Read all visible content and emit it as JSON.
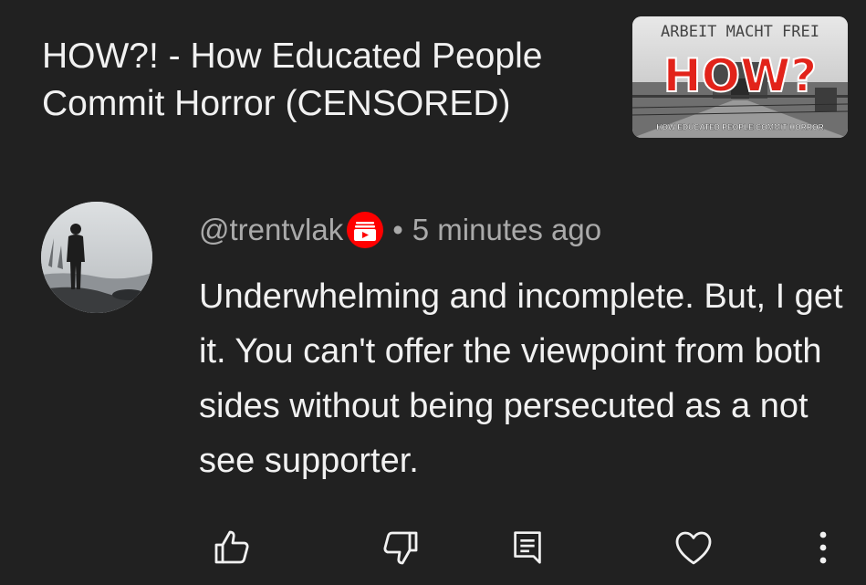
{
  "video": {
    "title": "HOW?! - How Educated People Commit Horror (CENSORED)",
    "thumbnail": {
      "top_sign": "ARBEIT MACHT FREI",
      "headline": "HOW?",
      "subline": "HOW EDUCATED PEOPLE COMMIT HORROR"
    }
  },
  "comment": {
    "author": "@trentvlak",
    "separator": "•",
    "time": "5 minutes ago",
    "text": "Underwhelming and incomplete. But, I get it. You can't offer the viewpoint from both sides without being persecuted as a not see supporter."
  },
  "actions": {
    "icons": [
      "thumbs-up-icon",
      "thumbs-down-icon",
      "reply-icon",
      "heart-icon",
      "more-vert-icon"
    ]
  },
  "colors": {
    "background": "#212121",
    "primary_text": "#f1f1f1",
    "secondary_text": "#aaaaaa",
    "badge_red": "#ff0000",
    "thumb_red": "#e2231a"
  }
}
